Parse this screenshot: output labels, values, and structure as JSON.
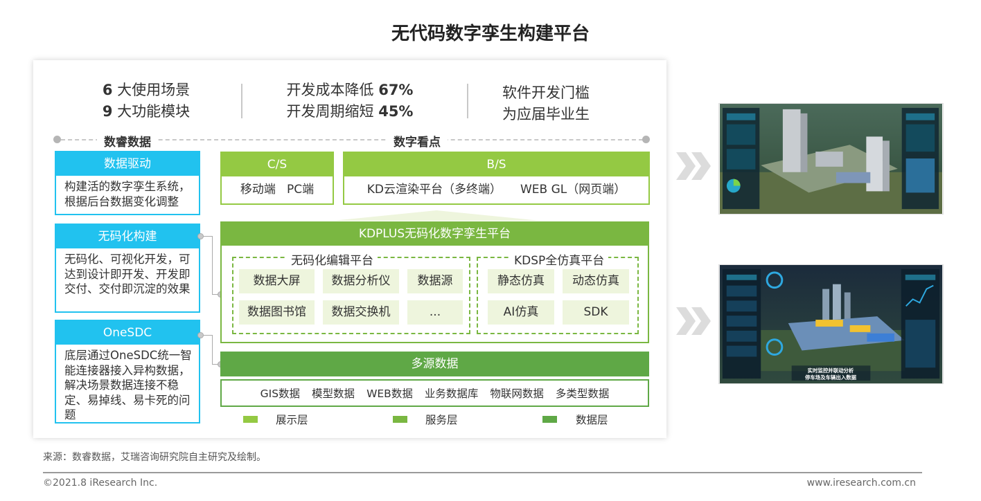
{
  "title": "无代码数字孪生构建平台",
  "kpis": [
    {
      "num": "6",
      "text": " 大使用场景"
    },
    {
      "num": "9",
      "text": " 大功能模块"
    },
    {
      "pre": "开发成本降低 ",
      "num": "67%"
    },
    {
      "pre": "开发周期缩短 ",
      "num": "45%"
    },
    {
      "text": "软件开发门槛"
    },
    {
      "text": "为应届毕业生"
    }
  ],
  "section_left": "数睿数据",
  "section_right": "数字看点",
  "features": [
    {
      "title": "数据驱动",
      "desc": "构建活的数字孪生系统，根据后台数据变化调整"
    },
    {
      "title": "无码化构建",
      "desc": "无码化、可视化开发，可达到设计即开发、开发即交付、交付即沉淀的效果"
    },
    {
      "title": "OneSDC",
      "desc": "底层通过OneSDC统一智能连接器接入异构数据，解决场景数据连接不稳定、易掉线、易卡死的问题"
    }
  ],
  "cs": {
    "title": "C/S",
    "body": "移动端   PC端"
  },
  "bs": {
    "title": "B/S",
    "body": "KD云渲染平台（多终端）     WEB GL（网页端）"
  },
  "kdplus": {
    "title": "KDPLUS无码化数字孪生平台",
    "editor_title": "无码化编辑平台",
    "editor_cells": [
      "数据大屏",
      "数据分析仪",
      "数据源",
      "数据图书馆",
      "数据交换机",
      "..."
    ],
    "kdsp_title": "KDSP全仿真平台",
    "kdsp_cells": [
      "静态仿真",
      "动态仿真",
      "AI仿真",
      "SDK"
    ]
  },
  "multi_source": "多源数据",
  "data_items": [
    "GIS数据",
    "模型数据",
    "WEB数据",
    "业务数据库",
    "物联网数据",
    "多类型数据"
  ],
  "legend": [
    {
      "label": "展示层",
      "color": "#94c943"
    },
    {
      "label": "服务层",
      "color": "#7ab741"
    },
    {
      "label": "数据层",
      "color": "#5fa846"
    }
  ],
  "screenshot_caption": "实时监控并联动分析 停车场及车辆出入数据",
  "source": "来源：数睿数据，艾瑞咨询研究院自主研究及绘制。",
  "copyright": "©2021.8 iResearch Inc.",
  "website": "www.iresearch.com.cn"
}
